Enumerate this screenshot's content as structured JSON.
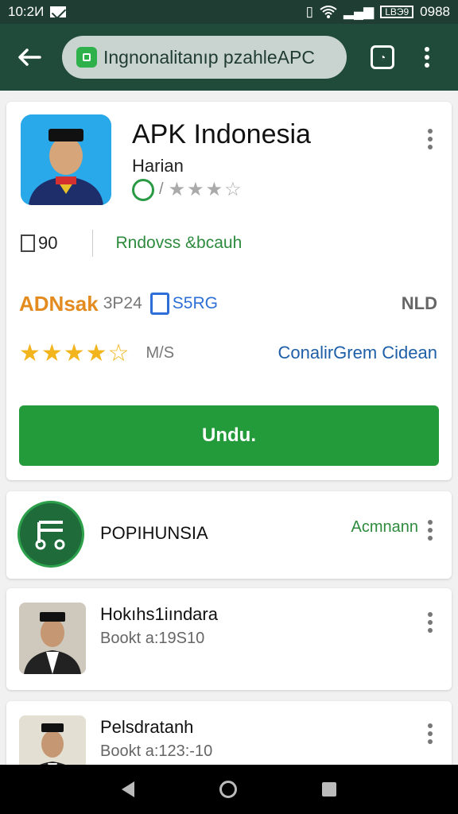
{
  "status_bar": {
    "time": "10:2И",
    "battery": "LBЭ9",
    "clock_right": "0988"
  },
  "toolbar": {
    "url": "Ingnonalitanıp pzahleAPC"
  },
  "app": {
    "title": "APK Indonesia",
    "subtitle": "Harian",
    "small_text": "/",
    "info_count": "90",
    "info_link": "Rndovss &bcauh",
    "brand": "ADNsak",
    "code": "3P24",
    "size": "S5RG",
    "meta_right": "NLD",
    "stars_count": "M/S",
    "stars_link": "ConalirGrem Cidean",
    "download_label": "Undu."
  },
  "rows": [
    {
      "title": "POPIHUNSIA",
      "action": "Acmnann"
    },
    {
      "title": "Hokıhs1iındara",
      "sub": "Bookt a:19S10"
    },
    {
      "title": "Pelsdratanh",
      "sub": "Bookt a:123:-10"
    }
  ],
  "colors": {
    "toolbar": "#204b3b",
    "primary": "#239b3b",
    "brand": "#e38b1f",
    "link_blue": "#1e5fa8"
  }
}
